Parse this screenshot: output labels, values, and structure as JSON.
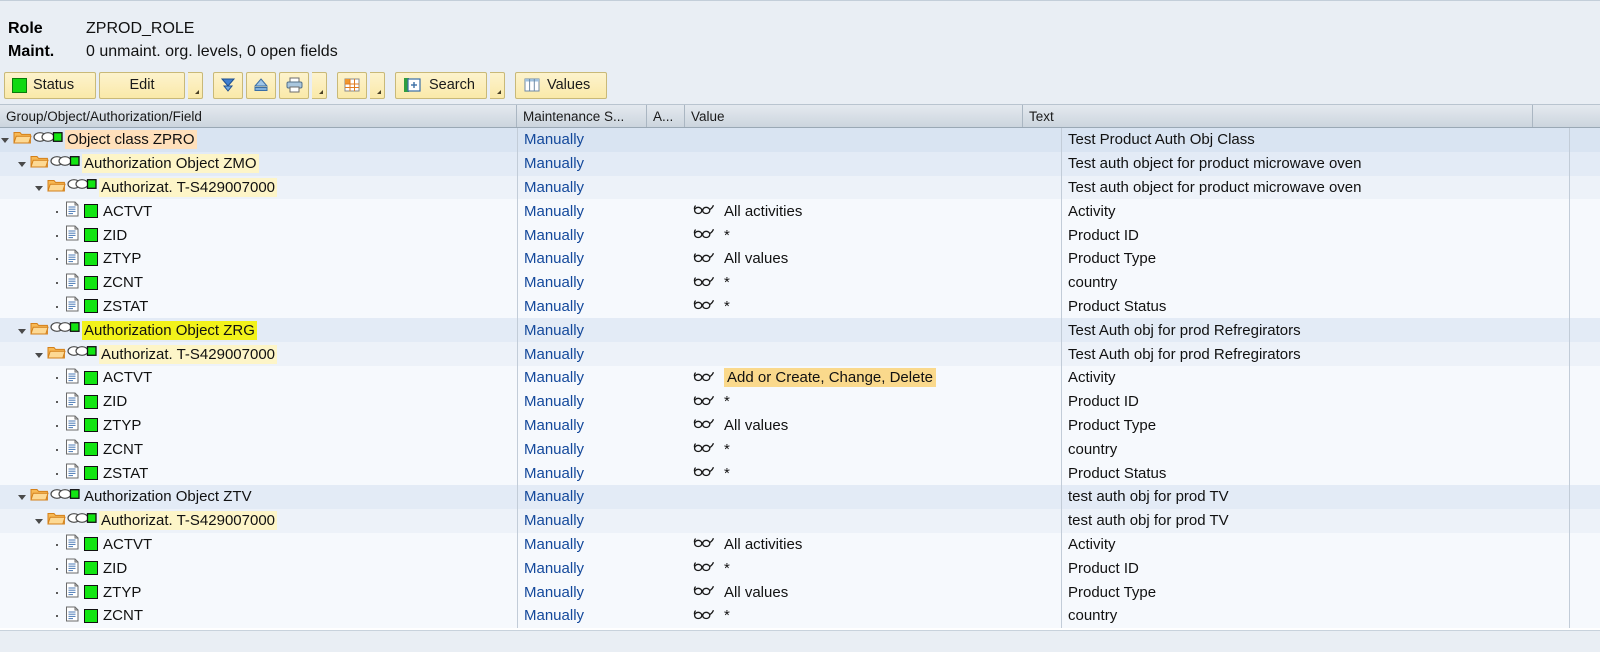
{
  "header": {
    "role_label": "Role",
    "role_value": "ZPROD_ROLE",
    "maint_label": "Maint.",
    "maint_value": "0 unmaint. org. levels, 0 open fields"
  },
  "toolbar": {
    "status_label": "Status",
    "edit_label": "Edit",
    "search_label": "Search",
    "values_label": "Values",
    "icons": [
      "status-green-square-icon",
      "edit-dropdown-icon",
      "expand-all-icon",
      "collapse-all-icon",
      "print-icon",
      "layout-grid-icon",
      "search-icon",
      "values-icon"
    ]
  },
  "columns": [
    {
      "key": "name",
      "label": "Group/Object/Authorization/Field"
    },
    {
      "key": "maint",
      "label": "Maintenance S..."
    },
    {
      "key": "auth",
      "label": "A..."
    },
    {
      "key": "value",
      "label": "Value"
    },
    {
      "key": "text",
      "label": "Text"
    }
  ],
  "colors": {
    "highlight_peach": "#ffe0bb",
    "highlight_cream": "#fdf5c8",
    "highlight_yellow": "#f2f21a",
    "highlight_amber": "#fad98c",
    "maint_text": "#13489b",
    "status_green": "#12e512"
  },
  "rows": [
    {
      "level": 0,
      "kind": "class",
      "name": "Object class ZPRO",
      "highlight": "peach",
      "maint": "Manually",
      "auth": "",
      "value": "",
      "value_highlight": "",
      "text": "Test Product Auth Obj Class"
    },
    {
      "level": 1,
      "kind": "object",
      "name": "Authorization Object ZMO",
      "highlight": "cream",
      "maint": "Manually",
      "auth": "",
      "value": "",
      "value_highlight": "",
      "text": "Test auth object for product microwave oven"
    },
    {
      "level": 2,
      "kind": "auth",
      "name": "Authorizat. T-S429007000",
      "highlight": "cream",
      "maint": "Manually",
      "auth": "",
      "value": "",
      "value_highlight": "",
      "text": "Test auth object for product microwave oven"
    },
    {
      "level": 3,
      "kind": "field",
      "name": "ACTVT",
      "highlight": "",
      "maint": "Manually",
      "auth": "glasses-icon",
      "value": "All activities",
      "value_highlight": "",
      "text": "Activity"
    },
    {
      "level": 3,
      "kind": "field",
      "name": "ZID",
      "highlight": "",
      "maint": "Manually",
      "auth": "glasses-icon",
      "value": "*",
      "value_highlight": "",
      "text": "Product ID"
    },
    {
      "level": 3,
      "kind": "field",
      "name": "ZTYP",
      "highlight": "",
      "maint": "Manually",
      "auth": "glasses-icon",
      "value": "All values",
      "value_highlight": "",
      "text": "Product Type"
    },
    {
      "level": 3,
      "kind": "field",
      "name": "ZCNT",
      "highlight": "",
      "maint": "Manually",
      "auth": "glasses-icon",
      "value": "*",
      "value_highlight": "",
      "text": "country"
    },
    {
      "level": 3,
      "kind": "field",
      "name": "ZSTAT",
      "highlight": "",
      "maint": "Manually",
      "auth": "glasses-icon",
      "value": "*",
      "value_highlight": "",
      "text": "Product Status"
    },
    {
      "level": 1,
      "kind": "object",
      "name": "Authorization Object ZRG",
      "highlight": "yellow",
      "maint": "Manually",
      "auth": "",
      "value": "",
      "value_highlight": "",
      "text": "Test Auth obj for prod Refregirators"
    },
    {
      "level": 2,
      "kind": "auth",
      "name": "Authorizat. T-S429007000",
      "highlight": "cream",
      "maint": "Manually",
      "auth": "",
      "value": "",
      "value_highlight": "",
      "text": "Test Auth obj for prod Refregirators"
    },
    {
      "level": 3,
      "kind": "field",
      "name": "ACTVT",
      "highlight": "",
      "maint": "Manually",
      "auth": "glasses-icon",
      "value": "Add or Create, Change, Delete",
      "value_highlight": "amber",
      "text": "Activity"
    },
    {
      "level": 3,
      "kind": "field",
      "name": "ZID",
      "highlight": "",
      "maint": "Manually",
      "auth": "glasses-icon",
      "value": "*",
      "value_highlight": "",
      "text": "Product ID"
    },
    {
      "level": 3,
      "kind": "field",
      "name": "ZTYP",
      "highlight": "",
      "maint": "Manually",
      "auth": "glasses-icon",
      "value": "All values",
      "value_highlight": "",
      "text": "Product Type"
    },
    {
      "level": 3,
      "kind": "field",
      "name": "ZCNT",
      "highlight": "",
      "maint": "Manually",
      "auth": "glasses-icon",
      "value": "*",
      "value_highlight": "",
      "text": "country"
    },
    {
      "level": 3,
      "kind": "field",
      "name": "ZSTAT",
      "highlight": "",
      "maint": "Manually",
      "auth": "glasses-icon",
      "value": "*",
      "value_highlight": "",
      "text": "Product Status"
    },
    {
      "level": 1,
      "kind": "object",
      "name": "Authorization Object ZTV",
      "highlight": "",
      "maint": "Manually",
      "auth": "",
      "value": "",
      "value_highlight": "",
      "text": "test auth obj for prod TV"
    },
    {
      "level": 2,
      "kind": "auth",
      "name": "Authorizat. T-S429007000",
      "highlight": "cream",
      "maint": "Manually",
      "auth": "",
      "value": "",
      "value_highlight": "",
      "text": "test auth obj for prod TV"
    },
    {
      "level": 3,
      "kind": "field",
      "name": "ACTVT",
      "highlight": "",
      "maint": "Manually",
      "auth": "glasses-icon",
      "value": "All activities",
      "value_highlight": "",
      "text": "Activity"
    },
    {
      "level": 3,
      "kind": "field",
      "name": "ZID",
      "highlight": "",
      "maint": "Manually",
      "auth": "glasses-icon",
      "value": "*",
      "value_highlight": "",
      "text": "Product ID"
    },
    {
      "level": 3,
      "kind": "field",
      "name": "ZTYP",
      "highlight": "",
      "maint": "Manually",
      "auth": "glasses-icon",
      "value": "All values",
      "value_highlight": "",
      "text": "Product Type"
    },
    {
      "level": 3,
      "kind": "field",
      "name": "ZCNT",
      "highlight": "",
      "maint": "Manually",
      "auth": "glasses-icon",
      "value": "*",
      "value_highlight": "",
      "text": "country"
    }
  ]
}
